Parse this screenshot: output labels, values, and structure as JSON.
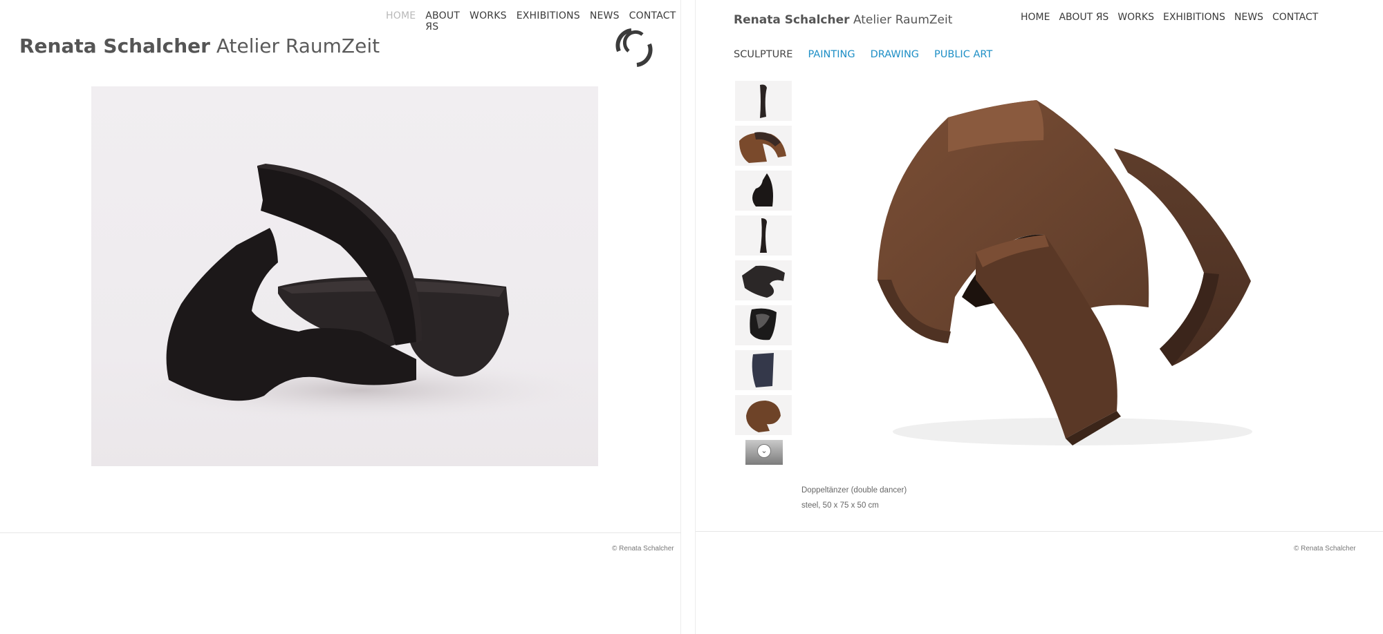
{
  "left_page": {
    "nav": [
      "HOME",
      "ABOUT ЯS",
      "WORKS",
      "EXHIBITIONS",
      "NEWS",
      "CONTACT"
    ],
    "active_nav": "HOME",
    "brand_name": "Renata Schalcher",
    "brand_sub": "Atelier RaumZeit",
    "copyright": "© Renata Schalcher"
  },
  "right_page": {
    "brand_name": "Renata Schalcher",
    "brand_sub": "Atelier RaumZeit",
    "nav": [
      "HOME",
      "ABOUT ЯS",
      "WORKS",
      "EXHIBITIONS",
      "NEWS",
      "CONTACT"
    ],
    "subnav": [
      "SCULPTURE",
      "PAINTING",
      "DRAWING",
      "PUBLIC ART"
    ],
    "current_subnav": "SCULPTURE",
    "caption": {
      "title": "Doppeltänzer (double dancer)",
      "details": "steel, 50 x 75 x 50 cm"
    },
    "copyright": "© Renata Schalcher"
  },
  "colors": {
    "accent_link": "#1e8fc6",
    "nav_active": "#b8b8b8",
    "sculpture_dark": "#1f1b1c",
    "sculpture_rust": "#6b4530"
  }
}
